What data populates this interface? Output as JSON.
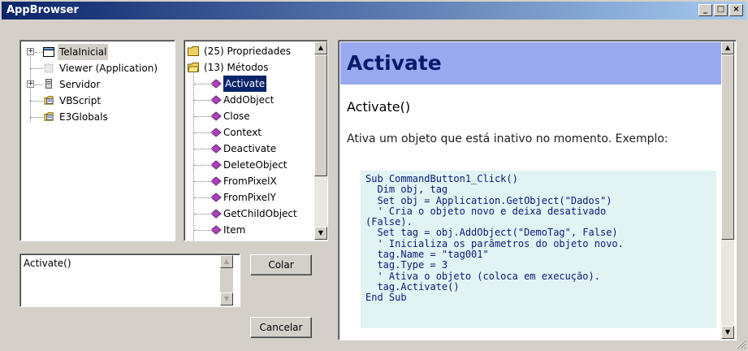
{
  "window": {
    "title": "AppBrowser"
  },
  "titlebar_buttons": {
    "minimize": "_",
    "maximize": "□",
    "close": "×"
  },
  "objects_tree": [
    {
      "label": "TelaInicial",
      "icon": "screen-icon",
      "expander": "+",
      "selected": true
    },
    {
      "label": "Viewer (Application)",
      "icon": "viewer-icon",
      "expander": ""
    },
    {
      "label": "Servidor",
      "icon": "server-icon",
      "expander": "+"
    },
    {
      "label": "VBScript",
      "icon": "script-folder-icon",
      "expander": ""
    },
    {
      "label": "E3Globals",
      "icon": "globals-folder-icon",
      "expander": ""
    }
  ],
  "members_tree": {
    "groups": [
      {
        "label": "(25) Propriedades",
        "icon": "folder-icon"
      },
      {
        "label": "(13) Métodos",
        "icon": "folder-open-icon"
      }
    ],
    "methods": [
      "Activate",
      "AddObject",
      "Close",
      "Context",
      "Deactivate",
      "DeleteObject",
      "FromPixelX",
      "FromPixelY",
      "GetChildObject",
      "Item"
    ],
    "selected": "Activate"
  },
  "preview": {
    "text": "Activate()"
  },
  "buttons": {
    "paste": "Colar",
    "cancel": "Cancelar"
  },
  "help": {
    "header": "Activate",
    "signature": "Activate()",
    "description": "Ativa um objeto que está inativo no momento. Exemplo:",
    "code": "Sub CommandButton1_Click()\n  Dim obj, tag\n  Set obj = Application.GetObject(\"Dados\")\n  ' Cria o objeto novo e deixa desativado\n(False).\n  Set tag = obj.AddObject(\"DemoTag\", False)\n  ' Inicializa os parâmetros do objeto novo.\n  tag.Name = \"tag001\"\n  tag.Type = 3\n  ' Ativa o objeto (coloca em execução).\n  tag.Activate()\nEnd Sub"
  },
  "colors": {
    "title_bar": "#0a246a",
    "help_header_bg": "#99aaf0",
    "code_bg": "#e1f3f3",
    "method_icon": "#b040c0"
  }
}
